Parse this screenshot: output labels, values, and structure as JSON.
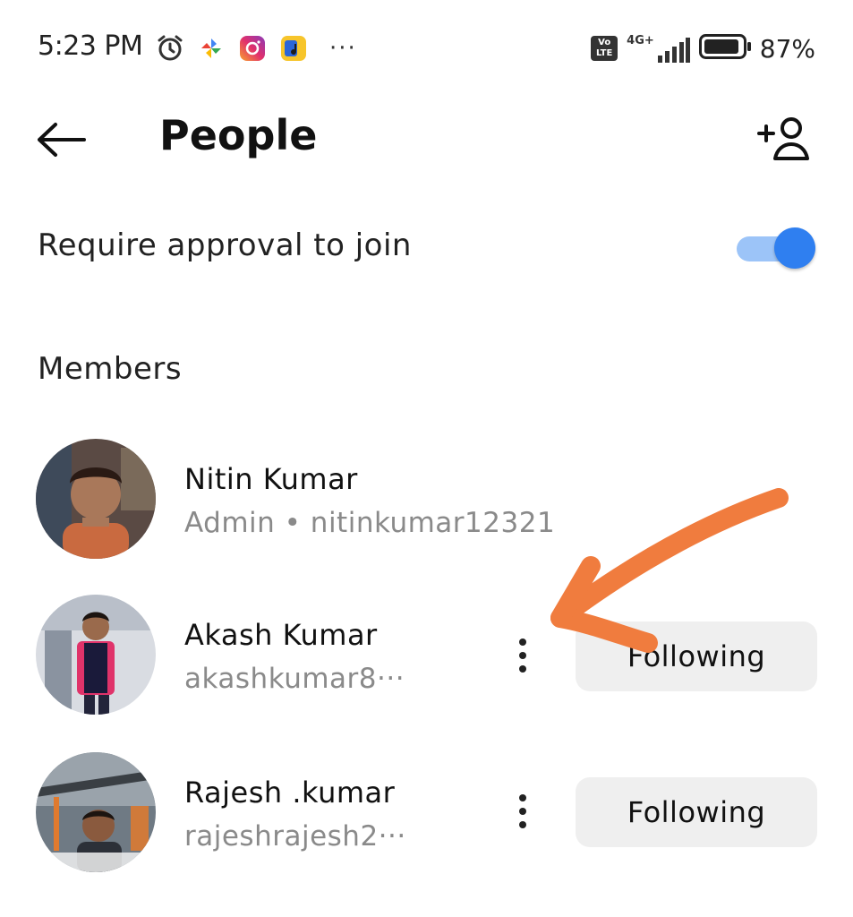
{
  "status_bar": {
    "time": "5:23 PM",
    "icons_left": [
      "alarm-icon",
      "pinwheel-app-icon",
      "instagram-icon",
      "music-app-icon"
    ],
    "more": "···",
    "volte_label": "Vo LTE",
    "network": "4G+",
    "battery_percent": "87%"
  },
  "header": {
    "title": "People",
    "back_icon": "arrow-left-icon",
    "add_icon": "add-person-icon"
  },
  "approval": {
    "label": "Require approval to join",
    "enabled": true,
    "accent": "#2f7ff0"
  },
  "members": {
    "title": "Members",
    "list": [
      {
        "name": "Nitin Kumar",
        "subtitle": "Admin • nitinkumar12321",
        "follow_label": ""
      },
      {
        "name": "Akash Kumar",
        "subtitle": "akashkumar8···",
        "follow_label": "Following"
      },
      {
        "name": "Rajesh .kumar",
        "subtitle": "rajeshrajesh2···",
        "follow_label": "Following"
      }
    ]
  },
  "annotation_color": "#f07c3e"
}
